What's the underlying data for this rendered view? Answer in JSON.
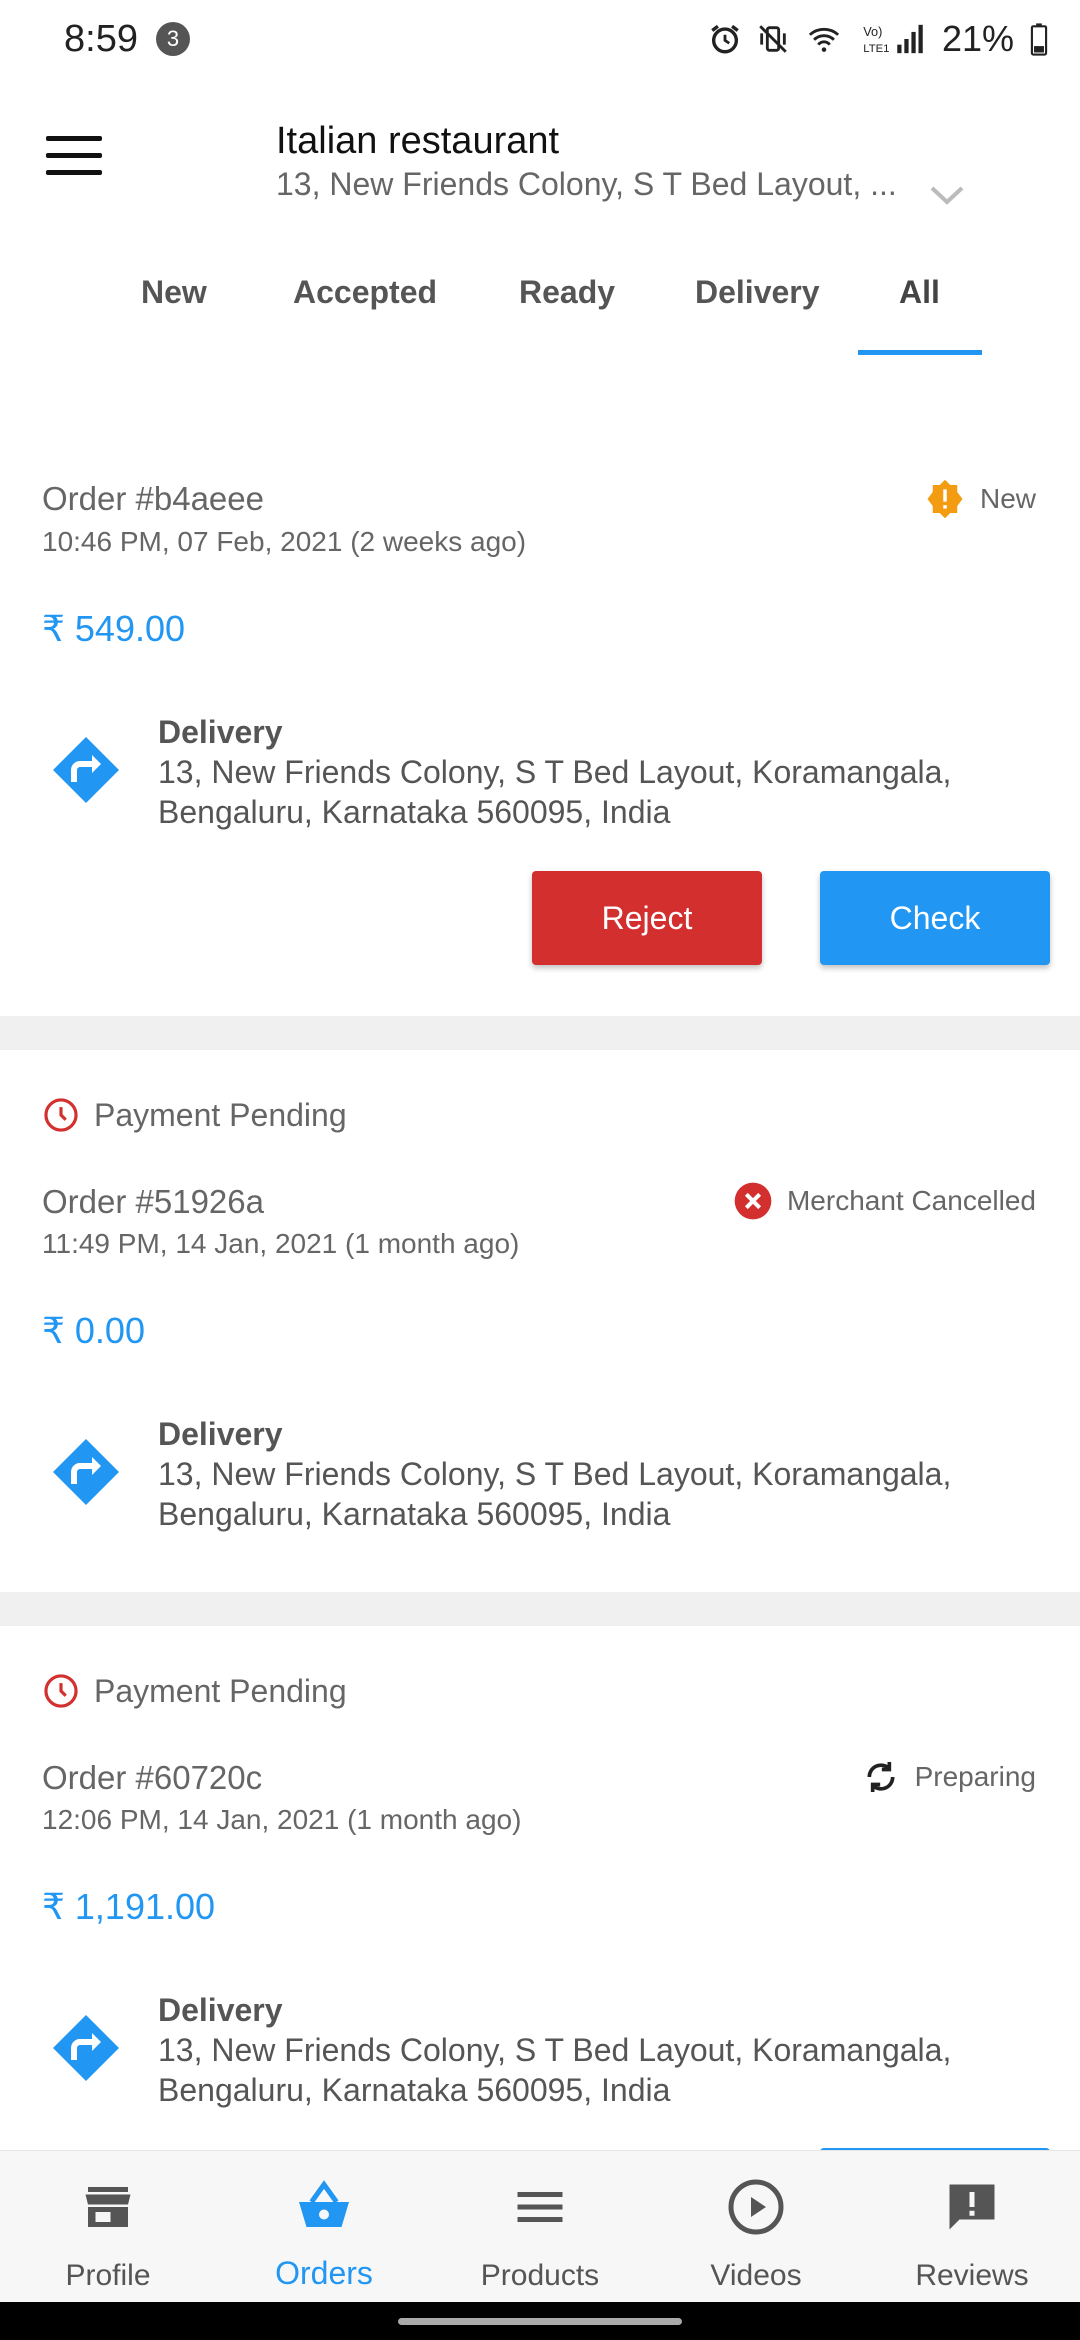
{
  "status_bar": {
    "time": "8:59",
    "notif_count": "3",
    "battery": "21%"
  },
  "header": {
    "title": "Italian restaurant",
    "address": "13, New Friends Colony, S T Bed Layout, ..."
  },
  "tabs": [
    {
      "label": "New"
    },
    {
      "label": "Accepted"
    },
    {
      "label": "Ready"
    },
    {
      "label": "Delivery"
    },
    {
      "label": "All"
    }
  ],
  "orders": [
    {
      "id": "Order #b4aeee",
      "time": "10:46 PM, 07 Feb, 2021  (2 weeks ago)",
      "status": "New",
      "amount": "₹ 549.00",
      "delivery_title": "Delivery",
      "delivery_address": "13, New Friends Colony, S T Bed Layout, Koramangala, Bengaluru, Karnataka 560095, India",
      "reject_label": "Reject",
      "check_label": "Check"
    },
    {
      "payment": "Payment Pending",
      "id": "Order #51926a",
      "time": "11:49 PM, 14 Jan, 2021  (1 month ago)",
      "status": "Merchant Cancelled",
      "amount": "₹ 0.00",
      "delivery_title": "Delivery",
      "delivery_address": "13, New Friends Colony, S T Bed Layout, Koramangala, Bengaluru, Karnataka 560095, India"
    },
    {
      "payment": "Payment Pending",
      "id": "Order #60720c",
      "time": "12:06 PM, 14 Jan, 2021  (1 month ago)",
      "status": "Preparing",
      "amount": "₹ 1,191.00",
      "delivery_title": "Delivery",
      "delivery_address": "13, New Friends Colony, S T Bed Layout, Koramangala, Bengaluru, Karnataka 560095, India"
    }
  ],
  "bottom_nav": [
    {
      "label": "Profile",
      "icon": "store-icon"
    },
    {
      "label": "Orders",
      "icon": "basket-icon"
    },
    {
      "label": "Products",
      "icon": "list-icon"
    },
    {
      "label": "Videos",
      "icon": "play-icon"
    },
    {
      "label": "Reviews",
      "icon": "feedback-icon"
    }
  ],
  "colors": {
    "accent": "#2196f3",
    "reject": "#d32f2f",
    "new_status": "#f39c12",
    "cancel_status": "#d32f2f"
  }
}
